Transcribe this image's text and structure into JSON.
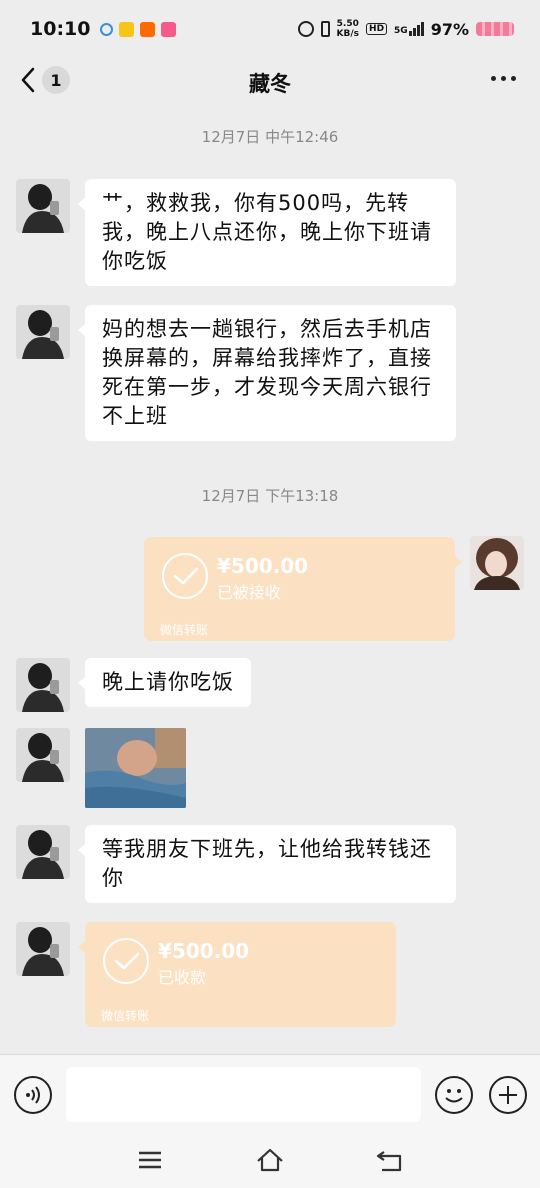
{
  "status_bar": {
    "time": "10:10",
    "net_speed_value": "5.50",
    "net_speed_unit": "KB/s",
    "hd": "HD",
    "signal": "5G",
    "battery": "97%"
  },
  "header": {
    "unread_count": "1",
    "title": "藏冬"
  },
  "messages": {
    "ts1": "12月7日 中午12:46",
    "m1": "艹，救救我，你有500吗，先转我，晚上八点还你，晚上你下班请你吃饭",
    "m2": "妈的想去一趟银行，然后去手机店换屏幕的，屏幕给我摔炸了，直接死在第一步，才发现今天周六银行不上班",
    "ts2": "12月7日 下午13:18",
    "t1_amount": "¥500.00",
    "t1_status": "已被接收",
    "t1_label": "微信转账",
    "m3": "晚上请你吃饭",
    "m4": "等我朋友下班先，让他给我转钱还你",
    "t2_amount": "¥500.00",
    "t2_status": "已收款",
    "t2_label": "微信转账"
  },
  "colors": {
    "transfer_bg": "#fbe1c2",
    "chat_bg": "#ededed",
    "bubble": "#ffffff"
  }
}
